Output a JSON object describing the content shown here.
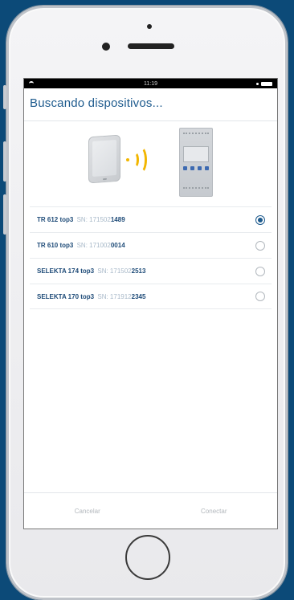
{
  "status_bar": {
    "time": "11:19"
  },
  "header": {
    "title": "Buscando dispositivos..."
  },
  "devices": [
    {
      "name": "TR 612 top3",
      "sn_prefix": "SN: 171502",
      "sn_suffix": "1489",
      "selected": true
    },
    {
      "name": "TR 610 top3",
      "sn_prefix": "SN: 171002",
      "sn_suffix": "0014",
      "selected": false
    },
    {
      "name": "SELEKTA 174 top3",
      "sn_prefix": "SN: 171502",
      "sn_suffix": "2513",
      "selected": false
    },
    {
      "name": "SELEKTA 170 top3",
      "sn_prefix": "SN: 171912",
      "sn_suffix": "2345",
      "selected": false
    }
  ],
  "footer": {
    "cancel_label": "Cancelar",
    "connect_label": "Conectar"
  },
  "colors": {
    "accent": "#1d5a8d",
    "signal": "#f2b600",
    "background": "#0c4a78"
  },
  "icons": {
    "wifi": "wifi-icon",
    "battery": "battery-icon",
    "tablet": "tablet-icon",
    "signal": "signal-waves-icon",
    "device": "timer-switch-device-icon"
  }
}
